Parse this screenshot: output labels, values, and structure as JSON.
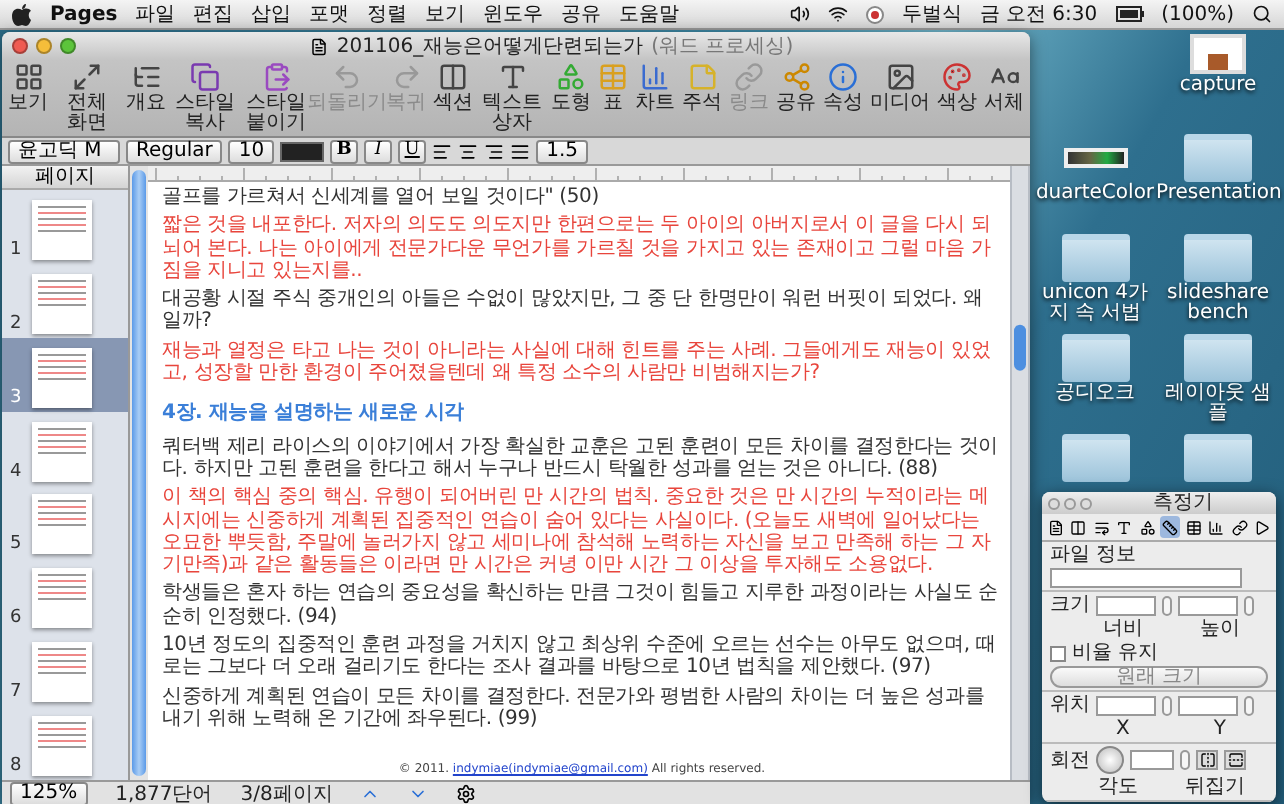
{
  "menu_bar": {
    "app": "Pages",
    "menus": [
      "파일",
      "편집",
      "삽입",
      "포맷",
      "정렬",
      "보기",
      "윈도우",
      "공유",
      "도움말"
    ],
    "input_source": "두벌식",
    "clock": "금 오전 6:30",
    "battery": "(100%)"
  },
  "window": {
    "title": "201106_재능은어떻게단련되는가",
    "subtitle": "(워드 프로세싱)"
  },
  "toolbar": [
    {
      "kind": "view",
      "label": "보기",
      "disabled": false
    },
    {
      "kind": "fullscreen",
      "label": "전체 화면",
      "disabled": false
    },
    {
      "kind": "outline",
      "label": "개요",
      "disabled": false
    },
    {
      "kind": "copy_style",
      "label": "스타일 복사",
      "disabled": false
    },
    {
      "kind": "paste_style",
      "label": "스타일 붙이기",
      "disabled": false
    },
    {
      "kind": "undo",
      "label": "되돌리기",
      "disabled": true
    },
    {
      "kind": "redo",
      "label": "복귀",
      "disabled": true
    },
    {
      "kind": "section",
      "label": "섹션",
      "disabled": false
    },
    {
      "kind": "text_box",
      "label": "텍스트 상자",
      "disabled": false
    },
    {
      "kind": "shape",
      "label": "도형",
      "disabled": false
    },
    {
      "kind": "table",
      "label": "표",
      "disabled": false
    },
    {
      "kind": "chart",
      "label": "차트",
      "disabled": false
    },
    {
      "kind": "comment",
      "label": "주석",
      "disabled": false
    },
    {
      "kind": "link",
      "label": "링크",
      "disabled": true
    },
    {
      "kind": "share",
      "label": "공유",
      "disabled": false
    },
    {
      "kind": "inspector",
      "label": "속성",
      "disabled": false
    },
    {
      "kind": "media",
      "label": "미디어",
      "disabled": false
    },
    {
      "kind": "colors",
      "label": "색상",
      "disabled": false
    },
    {
      "kind": "fonts",
      "label": "서체",
      "disabled": false
    }
  ],
  "format_bar": {
    "font": "윤고딕 M",
    "style": "Regular",
    "size": "10",
    "style_buttons": [
      "B",
      "I",
      "U"
    ],
    "line_spacing": "1.5"
  },
  "pages_panel": {
    "title": "페이지",
    "pages": [
      {
        "number": "1",
        "selected": false
      },
      {
        "number": "2",
        "selected": false
      },
      {
        "number": "3",
        "selected": true
      },
      {
        "number": "4",
        "selected": false
      },
      {
        "number": "5",
        "selected": false
      },
      {
        "number": "6",
        "selected": false
      },
      {
        "number": "7",
        "selected": false
      },
      {
        "number": "8",
        "selected": false
      }
    ]
  },
  "document": {
    "paragraphs": [
      {
        "kind": "body",
        "text": "골프를 가르쳐서 신세계를 열어 보일 것이다\" (50)"
      },
      {
        "kind": "note",
        "text": "짧은 것을 내포한다. 저자의 의도도 의도지만 한편으로는 두 아이의 아버지로서 이 글을 다시 되뇌어 본다. 나는 아이에게 전문가다운 무언가를 가르칠 것을 가지고 있는 존재이고 그럴 마음 가짐을 지니고 있는지를.."
      },
      {
        "kind": "body",
        "text": "대공황 시절 주식 중개인의 아들은 수없이 많았지만, 그 중 단 한명만이 워런 버핏이 되었다. 왜일까?"
      },
      {
        "kind": "note",
        "text": "재능과 열정은 타고 나는 것이 아니라는 사실에 대해 힌트를 주는 사례. 그들에게도 재능이 있었고, 성장할 만한 환경이 주어졌을텐데 왜 특정 소수의 사람만 비범해지는가?"
      },
      {
        "kind": "heading",
        "text": "4장.  재능을 설명하는 새로운 시각"
      },
      {
        "kind": "body",
        "text": "쿼터백 제리 라이스의 이야기에서 가장 확실한 교훈은 고된 훈련이 모든 차이를 결정한다는 것이다. 하지만 고된 훈련을 한다고 해서 누구나 반드시 탁월한 성과를 얻는 것은 아니다. (88)"
      },
      {
        "kind": "note",
        "text": "이 책의 핵심 중의 핵심. 유행이 되어버린 만 시간의 법칙. 중요한 것은 만 시간의 누적이라는 메시지에는 신중하게 계획된 집중적인 연습이 숨어 있다는 사실이다. (오늘도 새벽에 일어났다는 오묘한 뿌듯함, 주말에 놀러가지 않고 세미나에 참석해 노력하는 자신을 보고 만족해 하는 그 자기만족)과 같은 활동들은 이라면 만 시간은 커녕 이만 시간 그 이상을 투자해도 소용없다."
      },
      {
        "kind": "body",
        "text": "학생들은 혼자 하는 연습의 중요성을 확신하는 만큼 그것이 힘들고 지루한 과정이라는 사실도 순순히 인정했다. (94)"
      },
      {
        "kind": "body",
        "text": "10년 정도의 집중적인 훈련 과정을 거치지 않고 최상위 수준에 오르는 선수는 아무도 없으며, 때로는 그보다 더 오래 걸리기도 한다는 조사 결과를 바탕으로 10년 법칙을 제안했다. (97)"
      },
      {
        "kind": "body",
        "text": "신중하게 계획된 연습이 모든 차이를 결정한다. 전문가와 평범한 사람의 차이는 더 높은 성과를 내기 위해 노력해 온 기간에 좌우된다. (99)"
      }
    ],
    "footer_prefix": "© 2011.",
    "footer_link": "indymiae(indymiae@gmail.com)",
    "footer_suffix": "All rights reserved."
  },
  "status_bar": {
    "zoom": "125%",
    "word_count": "1,877단어",
    "page": "3/8페이지"
  },
  "desktop_icons": [
    {
      "kind": "screenshot",
      "label": "capture"
    },
    {
      "kind": "image",
      "label": "duarteColor"
    },
    {
      "kind": "folder",
      "label": "Presentation"
    },
    {
      "kind": "folder",
      "label": "unicon 4가지 속 서법"
    },
    {
      "kind": "folder",
      "label": "slideshare bench"
    },
    {
      "kind": "folder",
      "label": "공디오크"
    },
    {
      "kind": "folder",
      "label": "레이아웃 샘플"
    },
    {
      "kind": "folder"
    },
    {
      "kind": "folder"
    }
  ],
  "inspector": {
    "title": "측정기",
    "tabs": [
      {
        "kind": "document",
        "selected": false
      },
      {
        "kind": "layout",
        "selected": false
      },
      {
        "kind": "wrap",
        "selected": false
      },
      {
        "kind": "text",
        "selected": false
      },
      {
        "kind": "graphic",
        "selected": false
      },
      {
        "kind": "metrics",
        "selected": true
      },
      {
        "kind": "table",
        "selected": false
      },
      {
        "kind": "chart",
        "selected": false
      },
      {
        "kind": "link",
        "selected": false
      },
      {
        "kind": "media",
        "selected": false
      }
    ],
    "file_info_label": "파일 정보",
    "size_label": "크기",
    "width_label": "너비",
    "height_label": "높이",
    "constrain": {
      "label": "비율 유지",
      "checked": false
    },
    "original_size_button": "원래 크기",
    "position_label": "위치",
    "x_label": "X",
    "y_label": "Y",
    "rotate_label": "회전",
    "angle_label": "각도",
    "flip_label": "뒤집기"
  }
}
